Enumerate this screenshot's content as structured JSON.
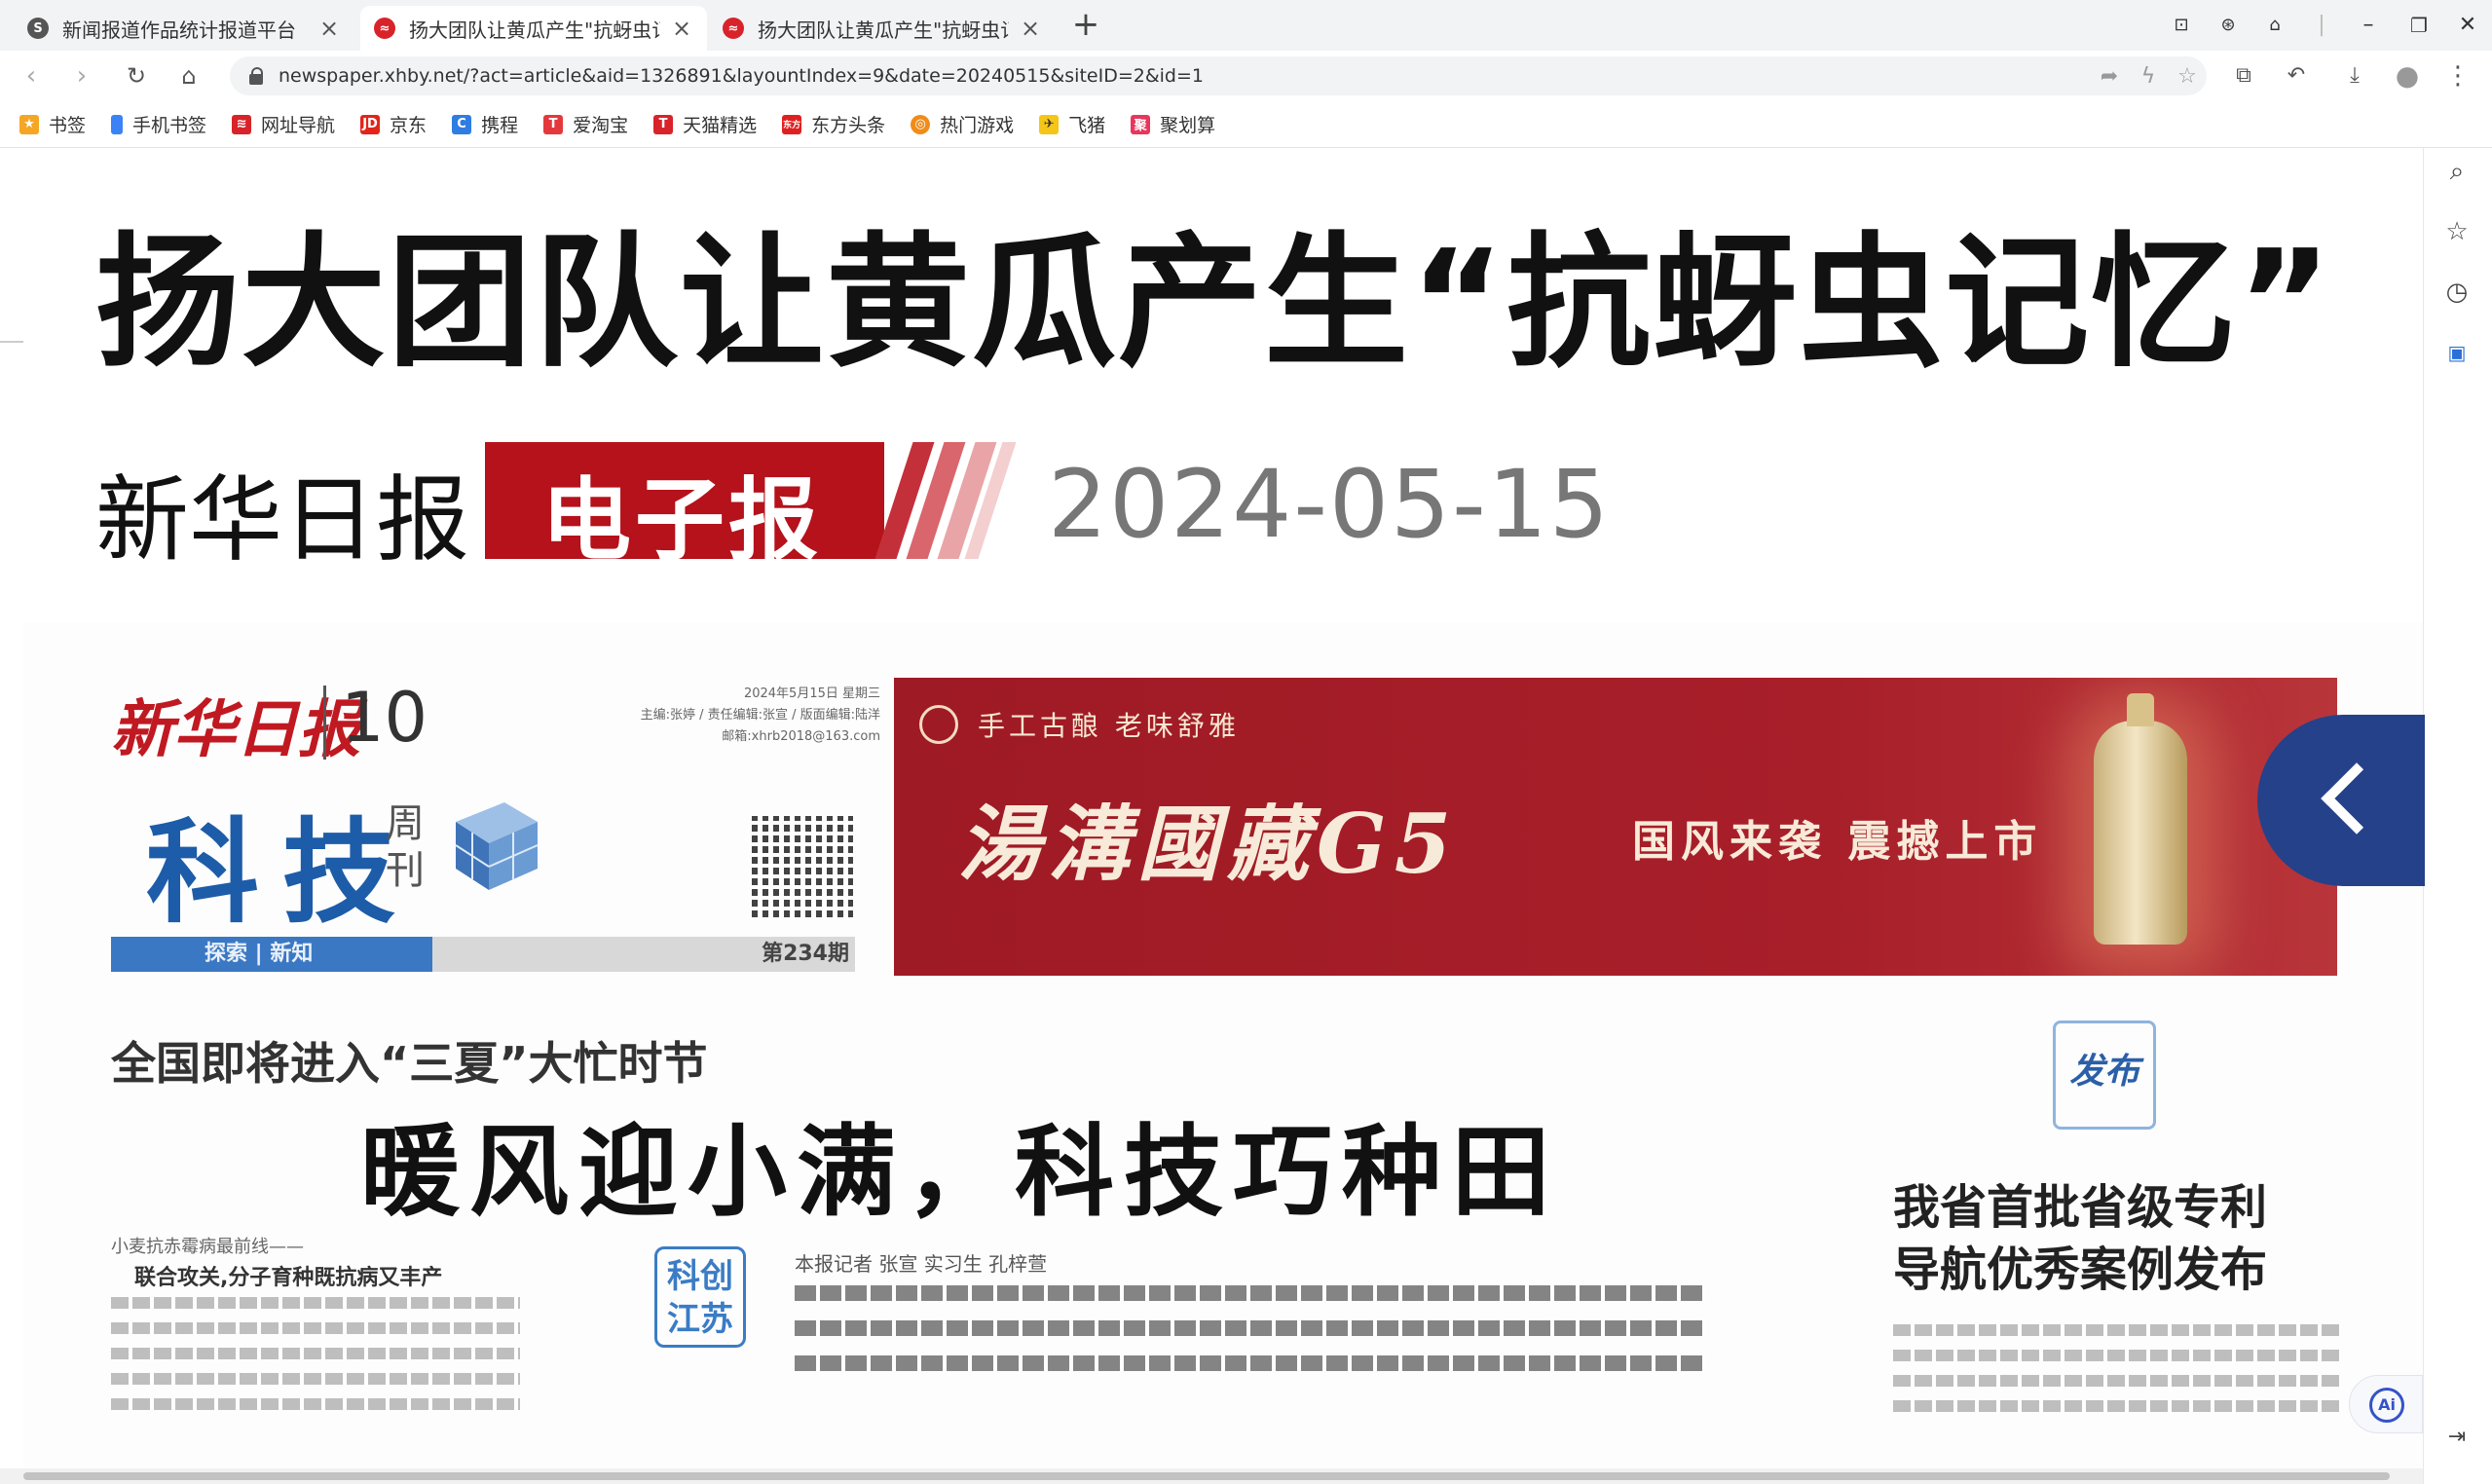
{
  "browser": {
    "tabs": [
      {
        "title": "新闻报道作品统计报道平台",
        "active": false,
        "favicon": "s-logo-icon"
      },
      {
        "title": "扬大团队让黄瓜产生\"抗蚜虫记忆\"",
        "active": true,
        "favicon": "xhby-logo-icon"
      },
      {
        "title": "扬大团队让黄瓜产生\"抗蚜虫记忆\"",
        "active": false,
        "favicon": "xhby-logo-icon"
      }
    ],
    "url": "newspaper.xhby.net/?act=article&aid=1326891&layountIndex=9&date=20240515&siteID=2&id=1",
    "bookmarks": [
      {
        "label": "书签",
        "color": "#f5a623"
      },
      {
        "label": "手机书签",
        "color": "#3b82f6"
      },
      {
        "label": "网址导航",
        "color": "#d8232a"
      },
      {
        "label": "京东",
        "color": "#e1251b"
      },
      {
        "label": "携程",
        "color": "#2f7de1"
      },
      {
        "label": "爱淘宝",
        "color": "#e4393c"
      },
      {
        "label": "天猫精选",
        "color": "#d8232a"
      },
      {
        "label": "东方头条",
        "color": "#e02020"
      },
      {
        "label": "热门游戏",
        "color": "#f08c1a"
      },
      {
        "label": "飞猪",
        "color": "#f5c518"
      },
      {
        "label": "聚划算",
        "color": "#e8365d"
      }
    ]
  },
  "article": {
    "headline": "扬大团队让黄瓜产生“抗蚜虫记忆”",
    "paper_name": "新华日报",
    "edition_badge": "电子报",
    "date": "2024-05-15"
  },
  "scan": {
    "logo": "新华日报",
    "page_number": "10",
    "meta_lines": [
      "2024年5月15日 星期三",
      "主编:张婷 / 责任编辑:张宣 / 版面编辑:陆洋",
      "邮箱:xhrb2018@163.com"
    ],
    "weekly_title": "科技",
    "weekly_small": "周刊",
    "bar_label": "探索 | 新知",
    "issue": "第234期",
    "ad": {
      "slogan": "手工古酿 老味舒雅",
      "brand": "湯溝國藏G5",
      "tagline": "国风来袭 震撼上市"
    },
    "kicker": "全国即将进入“三夏”大忙时节",
    "main_title": "暖风迎小满，科技巧种田",
    "sub_small": "小麦抗赤霉病最前线——",
    "sub_bold": "联合攻关,分子育种既抗病又丰产",
    "tag": "科创江苏",
    "byline": "本报记者 张宣 实习生 孔梓萱",
    "release_tag": "发布",
    "right_title": "我省首批省级专利导航优秀案例发布"
  },
  "side": {
    "ai_label": "Ai"
  },
  "colors": {
    "accent_red": "#b5121b",
    "scan_blue": "#3b78c4",
    "back_button": "#24418a"
  }
}
